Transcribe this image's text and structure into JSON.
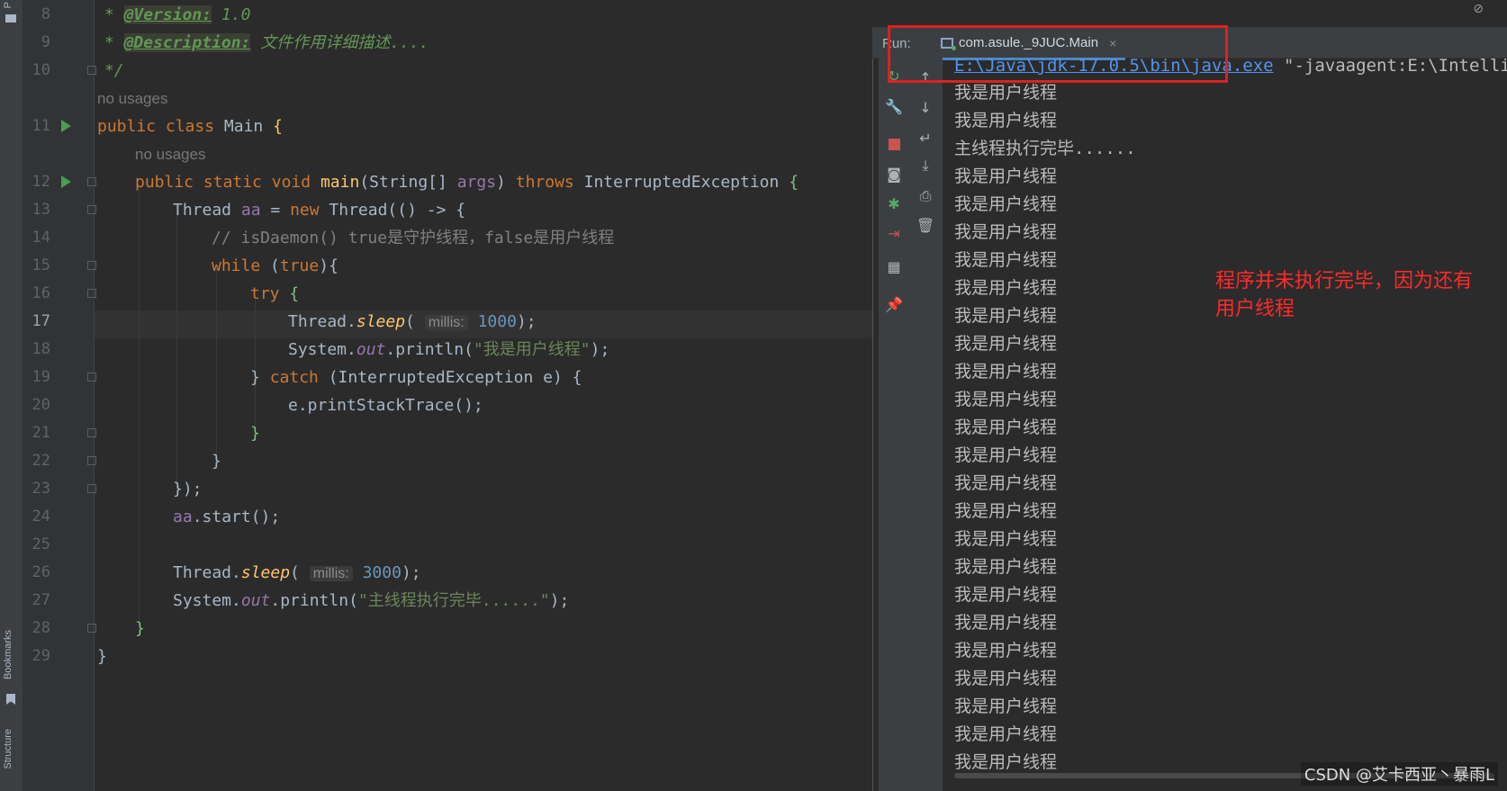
{
  "side": {
    "project_label": "P",
    "bookmarks_label": "Bookmarks",
    "structure_label": "Structure"
  },
  "editor": {
    "line_numbers": [
      "8",
      "9",
      "10",
      "11",
      "12",
      "13",
      "14",
      "15",
      "16",
      "17",
      "18",
      "19",
      "20",
      "21",
      "22",
      "23",
      "24",
      "25",
      "26",
      "27",
      "28",
      "29"
    ],
    "usage_hint_1": "no usages",
    "usage_hint_2": "no usages",
    "line8": {
      "prefix": " * ",
      "tag": "@Version:",
      "text": " 1.0"
    },
    "line9": {
      "prefix": " * ",
      "tag": "@Description:",
      "text": " 文件作用详细描述...."
    },
    "line10": " */",
    "line11": {
      "kw1": "public",
      "kw2": "class",
      "name": "Main",
      "brace": "{"
    },
    "line12": {
      "kw1": "public",
      "kw2": "static",
      "kw3": "void",
      "fn": "main",
      "p1": "(String[] ",
      "arg": "args",
      "p2": ") ",
      "kw4": "throws",
      "exc": " InterruptedException ",
      "brace": "{"
    },
    "line13": {
      "t1": "Thread ",
      "var": "aa",
      "t2": " = ",
      "kw": "new",
      "t3": " Thread(() -> {"
    },
    "line14": "// isDaemon() true是守护线程，false是用户线程",
    "line15": {
      "kw": "while",
      "t1": " (",
      "kw2": "true",
      "t2": "){"
    },
    "line16": {
      "kw": "try",
      "t1": " {"
    },
    "line17": {
      "t1": "Thread.",
      "fn": "sleep",
      "t2": "( ",
      "hint": "millis:",
      "num": "1000",
      "t3": ");"
    },
    "line18": {
      "t1": "System.",
      "field": "out",
      "t2": ".println(",
      "str": "\"我是用户线程\"",
      "t3": ");"
    },
    "line19": {
      "t1": "} ",
      "kw": "catch",
      "t2": " (InterruptedException e) {"
    },
    "line20": "e.printStackTrace();",
    "line21": "}",
    "line22": "}",
    "line23": "});",
    "line24": {
      "var": "aa",
      "t1": ".start();"
    },
    "line26": {
      "t1": "Thread.",
      "fn": "sleep",
      "t2": "( ",
      "hint": "millis:",
      "num": "3000",
      "t3": ");"
    },
    "line27": {
      "t1": "System.",
      "field": "out",
      "t2": ".println(",
      "str": "\"主线程执行完毕......\"",
      "t3": ");"
    },
    "line28": "}",
    "line29": "}"
  },
  "run_panel": {
    "label": "Run:",
    "tab_title": "com.asule._9JUC.Main",
    "tab_close": "×",
    "cmd_link": "E:\\Java\\jdk-17.0.5\\bin\\java.exe",
    "cmd_rest": " \"-javaagent:E:\\IntelliJ",
    "output_lines": [
      "我是用户线程",
      "我是用户线程",
      "主线程执行完毕......",
      "我是用户线程",
      "我是用户线程",
      "我是用户线程",
      "我是用户线程",
      "我是用户线程",
      "我是用户线程",
      "我是用户线程",
      "我是用户线程",
      "我是用户线程",
      "我是用户线程",
      "我是用户线程",
      "我是用户线程",
      "我是用户线程",
      "我是用户线程",
      "我是用户线程",
      "我是用户线程",
      "我是用户线程",
      "我是用户线程",
      "我是用户线程",
      "我是用户线程",
      "我是用户线程",
      "我是用户线程"
    ],
    "toolbar_left": [
      "rerun-icon",
      "wrench-icon",
      "stop-icon",
      "camera-icon",
      "debug-icon",
      "exit-icon",
      "layout-icon",
      "pin-icon"
    ],
    "toolbar_right": [
      "up-arrow-icon",
      "down-arrow-icon",
      "soft-wrap-icon",
      "scroll-end-icon",
      "print-icon",
      "trash-icon"
    ]
  },
  "annotation": "程序并未执行完毕，因为还有用户线程",
  "watermark": "CSDN @艾卡西亚丶暴雨L",
  "colors": {
    "highlight_box": "#e02020",
    "annotation": "#ff2a2a",
    "accent": "#4a88c7"
  }
}
